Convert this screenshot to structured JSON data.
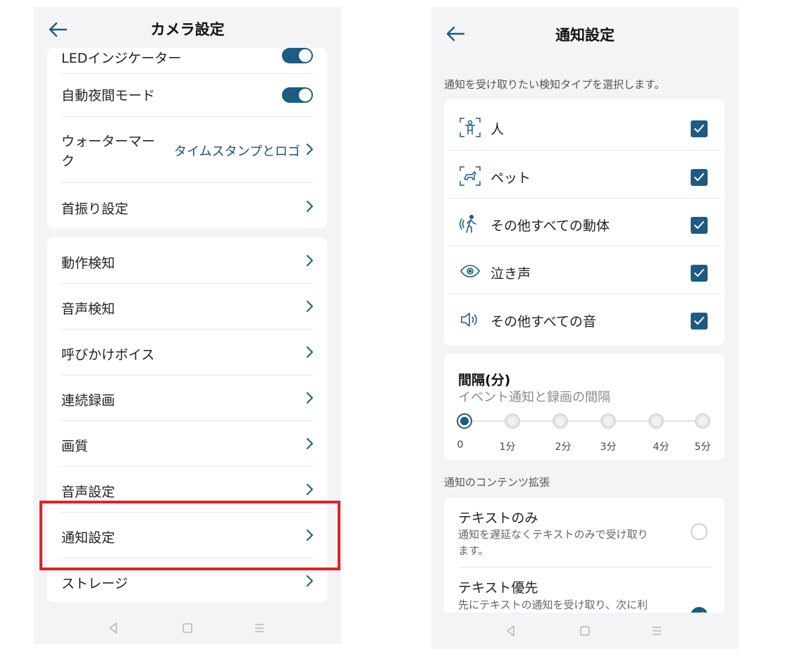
{
  "left_screen": {
    "header": {
      "title": "カメラ設定",
      "back_icon": "arrow-left-icon"
    },
    "card1": {
      "led_label": "LEDインジケーター",
      "night_mode_label": "自動夜間モード",
      "watermark_label_line1": "ウォーターマー",
      "watermark_label_line2": "ク",
      "watermark_value": "タイムスタンプとロゴ",
      "pan_label": "首振り設定"
    },
    "card2": {
      "items": [
        {
          "label": "動作検知"
        },
        {
          "label": "音声検知"
        },
        {
          "label": "呼びかけボイス"
        },
        {
          "label": "連続録画"
        },
        {
          "label": "画質"
        },
        {
          "label": "音声設定"
        },
        {
          "label": "通知設定"
        },
        {
          "label": "ストレージ"
        }
      ]
    },
    "highlight_color": "#e1222b"
  },
  "right_screen": {
    "header": {
      "title": "通知設定",
      "back_icon": "arrow-left-icon"
    },
    "detect_prompt": "通知を受け取りたい検知タイプを選択します。",
    "detect_types": [
      {
        "label": "人",
        "icon": "person-detect-icon",
        "checked": true
      },
      {
        "label": "ペット",
        "icon": "pet-detect-icon",
        "checked": true
      },
      {
        "label": "その他すべての動体",
        "icon": "walking-motion-icon",
        "checked": true
      },
      {
        "label": "泣き声",
        "icon": "eye-icon",
        "checked": true
      },
      {
        "label": "その他すべての音",
        "icon": "speaker-icon",
        "checked": true
      }
    ],
    "interval": {
      "title": "間隔(分)",
      "subtitle": "イベント通知と録画の間隔",
      "options": [
        "0",
        "1分",
        "2分",
        "3分",
        "4分",
        "5分"
      ],
      "selected_index": 0
    },
    "content_label": "通知のコンテンツ拡張",
    "content_options": [
      {
        "title": "テキストのみ",
        "desc_line1": "通知を遅延なくテキストのみで受け取り",
        "desc_line2": "ます。",
        "selected": false
      },
      {
        "title": "テキスト優先",
        "desc_line1": "先にテキストの通知を受け取り、次に利",
        "selected": true
      }
    ]
  },
  "colors": {
    "accent": "#1d5b82",
    "link": "#1d4f73"
  }
}
